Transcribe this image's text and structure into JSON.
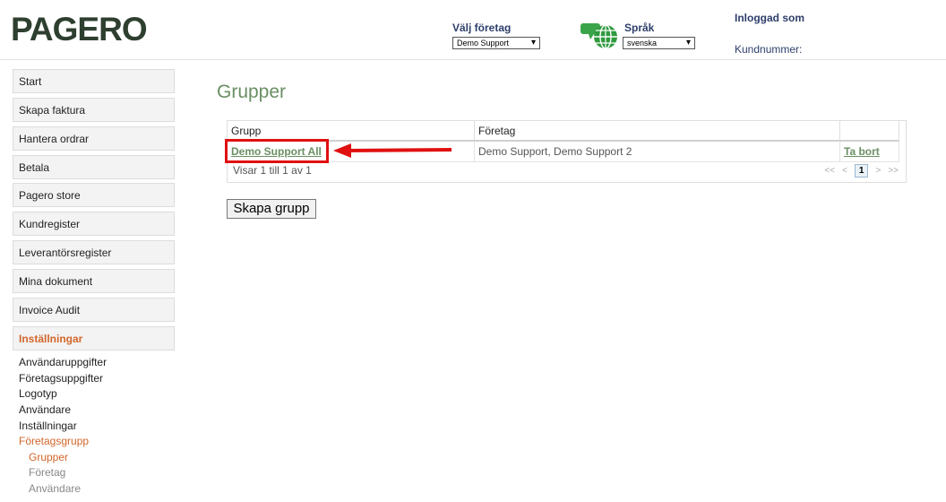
{
  "brand": {
    "logo_text": "PAGERO"
  },
  "header": {
    "company_label": "Välj företag",
    "company_selected": "Demo Support",
    "language_label": "Språk",
    "language_selected": "svenska",
    "logged_in_label": "Inloggad som",
    "customer_number_label": "Kundnummer:"
  },
  "nav": {
    "items": [
      {
        "label": "Start"
      },
      {
        "label": "Skapa faktura"
      },
      {
        "label": "Hantera ordrar"
      },
      {
        "label": "Betala"
      },
      {
        "label": "Pagero store"
      },
      {
        "label": "Kundregister"
      },
      {
        "label": "Leverantörsregister"
      },
      {
        "label": "Mina dokument"
      },
      {
        "label": "Invoice Audit"
      },
      {
        "label": "Inställningar"
      }
    ],
    "settings_sub": [
      {
        "label": "Användaruppgifter"
      },
      {
        "label": "Företagsuppgifter"
      },
      {
        "label": "Logotyp"
      },
      {
        "label": "Användare"
      },
      {
        "label": "Inställningar"
      },
      {
        "label": "Företagsgrupp"
      }
    ],
    "group_sub": [
      {
        "label": "Grupper"
      },
      {
        "label": "Företag"
      },
      {
        "label": "Användare"
      }
    ]
  },
  "main": {
    "title": "Grupper",
    "table": {
      "columns": [
        "Grupp",
        "Företag"
      ],
      "rows": [
        {
          "group": "Demo Support All",
          "companies": "Demo Support, Demo Support 2",
          "action": "Ta bort"
        }
      ],
      "footer": "Visar 1 till 1 av 1",
      "pager": {
        "first": "<<",
        "prev": "<",
        "current": "1",
        "next": ">",
        "last": ">>"
      }
    },
    "create_button": "Skapa grupp"
  },
  "colors": {
    "accent": "#d2662b",
    "green": "#6a8f63",
    "annotation": "#e01010"
  }
}
